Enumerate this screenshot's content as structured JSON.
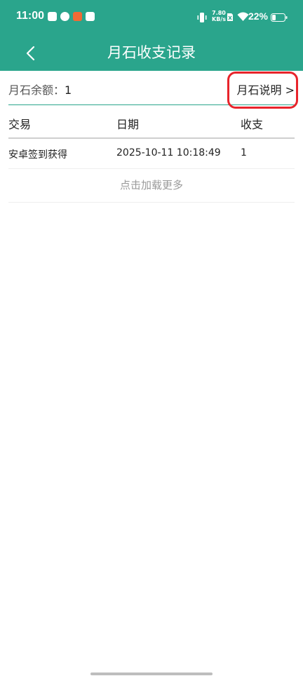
{
  "status_bar": {
    "time": "11:00",
    "network_speed_value": "7.80",
    "network_speed_unit": "KB/s",
    "battery_percent": "22%"
  },
  "header": {
    "title": "月石收支记录"
  },
  "balance": {
    "label": "月石余额：",
    "value": "1",
    "explain_link": "月石说明 >"
  },
  "table": {
    "columns": [
      "交易",
      "日期",
      "收支"
    ],
    "rows": [
      {
        "transaction": "安卓签到获得",
        "date": "2025-10-11 10:18:49",
        "amount": "1"
      }
    ],
    "load_more": "点击加载更多"
  },
  "colors": {
    "header_bg": "#2aa58c",
    "highlight": "#e8242b"
  }
}
